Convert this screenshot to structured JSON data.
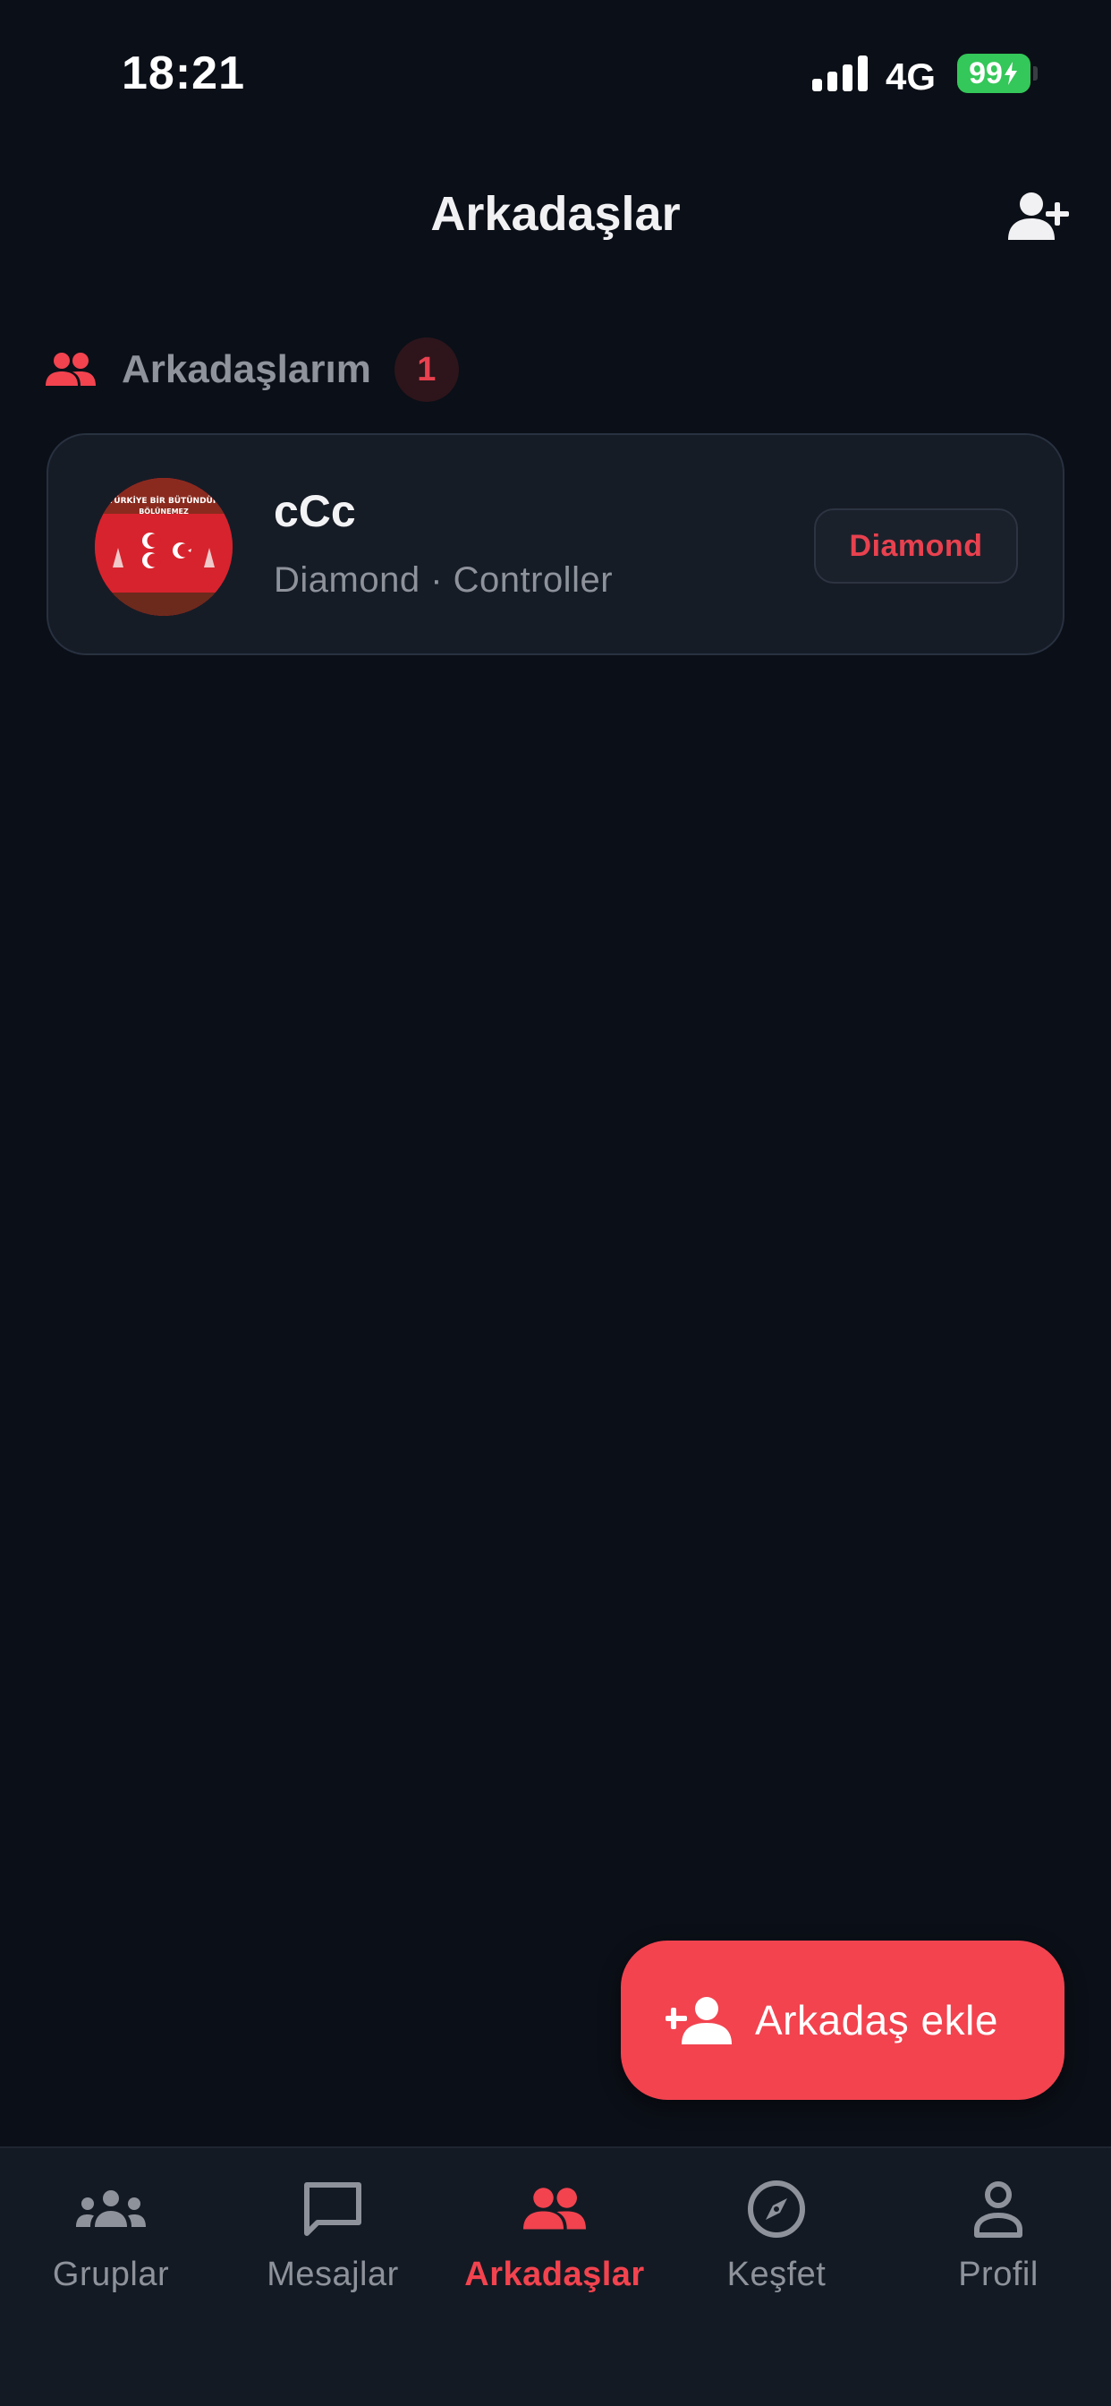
{
  "status_bar": {
    "time": "18:21",
    "network": "4G",
    "battery": "99"
  },
  "header": {
    "title": "Arkadaşlar",
    "add_icon": "person-add-icon"
  },
  "section": {
    "label": "Arkadaşlarım",
    "count": "1",
    "icon": "people-icon"
  },
  "friends": [
    {
      "name": "cCc",
      "subtitle": "Diamond · Controller",
      "rank": "Diamond",
      "avatar_text_line1": "TÜRKİYE BİR BÜTÜNDÜR",
      "avatar_text_line2": "BÖLÜNEMEZ"
    }
  ],
  "fab": {
    "label": "Arkadaş ekle",
    "icon": "person-add-icon"
  },
  "nav": {
    "items": [
      {
        "label": "Gruplar",
        "icon": "groups-icon"
      },
      {
        "label": "Mesajlar",
        "icon": "chat-icon"
      },
      {
        "label": "Arkadaşlar",
        "icon": "people-icon"
      },
      {
        "label": "Keşfet",
        "icon": "compass-icon"
      },
      {
        "label": "Profil",
        "icon": "profile-icon"
      }
    ],
    "active": "Arkadaşlar"
  },
  "colors": {
    "background": "#0b0f17",
    "card": "#161c26",
    "accent": "#f2434f",
    "muted_text": "#8d929b",
    "battery": "#34c759"
  }
}
